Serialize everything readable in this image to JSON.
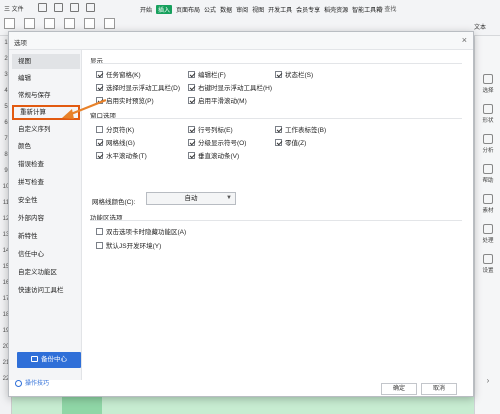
{
  "ribbon": {
    "menu": "三 文件",
    "tabs": [
      "开始",
      "插入",
      "页面布局",
      "公式",
      "数据",
      "审阅",
      "视图",
      "开发工具",
      "会员专享",
      "稻壳资源",
      "智能工具箱"
    ],
    "active_tab": "插入",
    "search": "Q 查找",
    "right_top": "文本"
  },
  "right_sidebar": {
    "items": [
      "选择",
      "形状",
      "分析",
      "帮助",
      "素材",
      "处理",
      "设置"
    ]
  },
  "row_numbers": [
    "1",
    "2",
    "3",
    "4",
    "5",
    "6",
    "7",
    "8",
    "9",
    "10",
    "11",
    "12",
    "13",
    "14",
    "15",
    "16",
    "17",
    "18",
    "19",
    "20",
    "21",
    "22"
  ],
  "dialog": {
    "title": "选项",
    "close": "×",
    "nav": [
      "视图",
      "编辑",
      "常规与保存",
      "重新计算",
      "自定义序列",
      "颜色",
      "错误检查",
      "拼写检查",
      "安全性",
      "外部内容",
      "新特性",
      "信任中心",
      "自定义功能区",
      "快速访问工具栏"
    ],
    "active_nav": "视图",
    "backup_label": "备份中心",
    "tips_label": "操作技巧",
    "sections": {
      "display": {
        "title": "显示",
        "items": [
          {
            "label": "任务窗格(K)",
            "checked": true
          },
          {
            "label": "编辑栏(F)",
            "checked": true
          },
          {
            "label": "状态栏(S)",
            "checked": true
          },
          {
            "label": "选择时显示浮动工具栏(D)",
            "checked": true
          },
          {
            "label": "右键时显示浮动工具栏(H)",
            "checked": true
          },
          {
            "label": "启用实时预览(P)",
            "checked": true
          },
          {
            "label": "启用平滑滚动(M)",
            "checked": true
          }
        ]
      },
      "window": {
        "title": "窗口选项",
        "items": [
          {
            "label": "分页符(K)",
            "checked": false
          },
          {
            "label": "行号列标(E)",
            "checked": true
          },
          {
            "label": "工作表标签(B)",
            "checked": true
          },
          {
            "label": "网格线(G)",
            "checked": true
          },
          {
            "label": "分级显示符号(O)",
            "checked": true
          },
          {
            "label": "零值(Z)",
            "checked": true
          },
          {
            "label": "水平滚动条(T)",
            "checked": true
          },
          {
            "label": "垂直滚动条(V)",
            "checked": true
          }
        ],
        "gridline_color_label": "网格线颜色(C):",
        "gridline_color_value": "自动"
      },
      "ribbon_opts": {
        "title": "功能区选项",
        "items": [
          {
            "label": "双击选项卡时隐藏功能区(A)",
            "checked": false
          },
          {
            "label": "默认JS开发环境(Y)",
            "checked": false
          }
        ]
      }
    },
    "footer": {
      "ok": "确定",
      "cancel": "取消"
    }
  },
  "colors": {
    "accent": "#2f6fd8",
    "highlight": "#e25a10",
    "wps_green": "#17a05d"
  }
}
